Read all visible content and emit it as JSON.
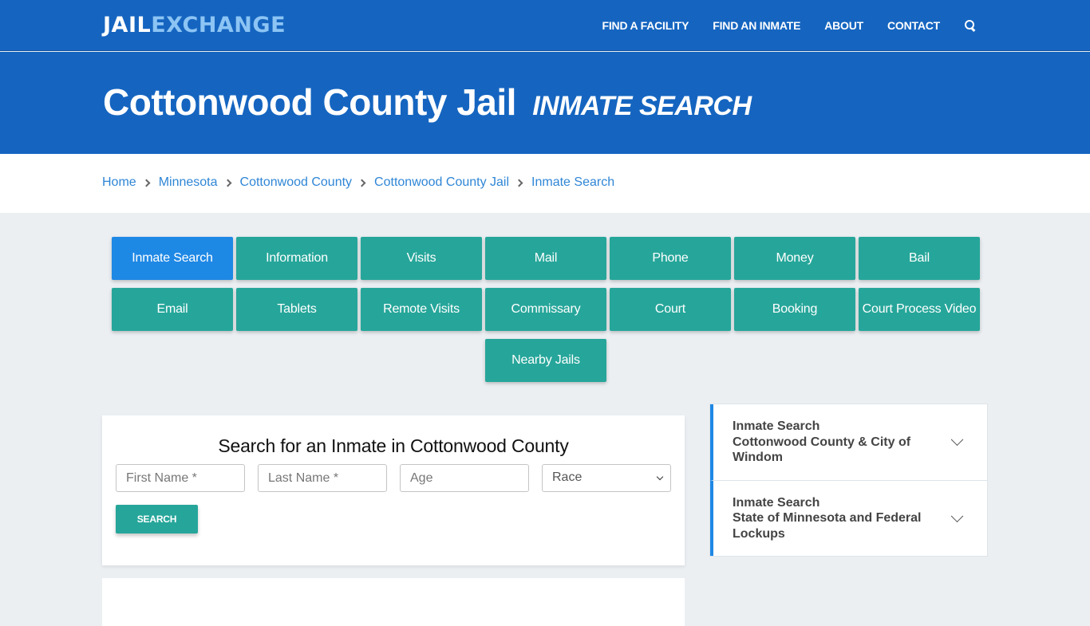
{
  "header": {
    "logo_part1": "JAIL",
    "logo_part2": "EXCHANGE",
    "nav": [
      "FIND A FACILITY",
      "FIND AN INMATE",
      "ABOUT",
      "CONTACT"
    ],
    "search_icon": "search-icon"
  },
  "hero": {
    "title": "Cottonwood County Jail",
    "subtitle": "INMATE SEARCH"
  },
  "breadcrumb": [
    "Home",
    "Minnesota",
    "Cottonwood County",
    "Cottonwood County Jail",
    "Inmate Search"
  ],
  "tiles": [
    {
      "label": "Inmate Search",
      "active": true
    },
    {
      "label": "Information"
    },
    {
      "label": "Visits"
    },
    {
      "label": "Mail"
    },
    {
      "label": "Phone"
    },
    {
      "label": "Money"
    },
    {
      "label": "Bail"
    },
    {
      "label": "Email"
    },
    {
      "label": "Tablets"
    },
    {
      "label": "Remote Visits"
    },
    {
      "label": "Commissary"
    },
    {
      "label": "Court"
    },
    {
      "label": "Booking"
    },
    {
      "label": "Court Process Video"
    },
    {
      "label": "Nearby Jails"
    }
  ],
  "search_form": {
    "title": "Search for an Inmate in Cottonwood County",
    "first_name_placeholder": "First Name *",
    "last_name_placeholder": "Last Name *",
    "age_placeholder": "Age",
    "race_selected": "Race",
    "search_label": "SEARCH"
  },
  "sidebar": {
    "items": [
      {
        "line1": "Inmate Search",
        "line2": "Cottonwood County & City of Windom"
      },
      {
        "line1": "Inmate Search",
        "line2": "State of Minnesota and Federal Lockups"
      }
    ]
  },
  "colors": {
    "brand_blue": "#1565c0",
    "logo_accent": "#8cc4f4",
    "tile_teal": "#26a69a",
    "tile_active": "#1e88e5",
    "link_blue": "#2f86d6"
  }
}
